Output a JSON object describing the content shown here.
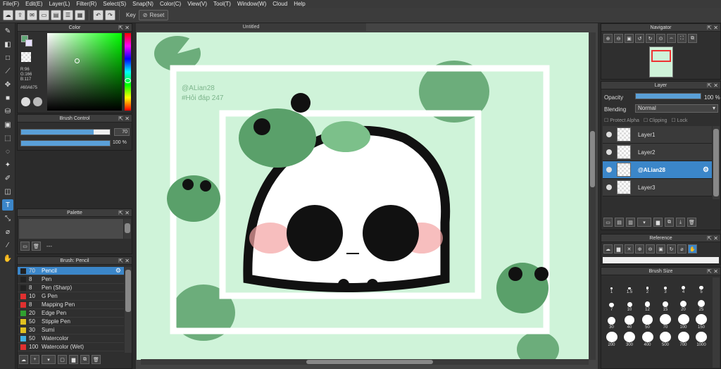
{
  "menu": [
    "File(F)",
    "Edit(E)",
    "Layer(L)",
    "Filter(R)",
    "Select(S)",
    "Snap(N)",
    "Color(C)",
    "View(V)",
    "Tool(T)",
    "Window(W)",
    "Cloud",
    "Help"
  ],
  "toolbar": {
    "key_label": "Key",
    "reset_label": "Reset"
  },
  "color_panel": {
    "title": "Color",
    "r": "R:96",
    "g": "G:166",
    "b": "B:117",
    "hex": "#60A675",
    "fg_color": "#60A675"
  },
  "brush_control": {
    "title": "Brush Control",
    "size_value": "70",
    "opacity_value": "100 %",
    "size_fraction": 0.82,
    "opacity_fraction": 1.0
  },
  "palette": {
    "title": "Palette",
    "dash": "---"
  },
  "brush_list": {
    "title": "Brush: Pencil",
    "items": [
      {
        "size": "70",
        "name": "Pencil",
        "color": "#222222",
        "selected": true
      },
      {
        "size": "8",
        "name": "Pen",
        "color": "#222222"
      },
      {
        "size": "8",
        "name": "Pen (Sharp)",
        "color": "#222222"
      },
      {
        "size": "10",
        "name": "G Pen",
        "color": "#e03030"
      },
      {
        "size": "8",
        "name": "Mapping Pen",
        "color": "#e03030"
      },
      {
        "size": "20",
        "name": "Edge Pen",
        "color": "#30a030"
      },
      {
        "size": "50",
        "name": "Stipple Pen",
        "color": "#e0c020"
      },
      {
        "size": "30",
        "name": "Sumi",
        "color": "#e0c020"
      },
      {
        "size": "50",
        "name": "Watercolor",
        "color": "#40b0e0"
      },
      {
        "size": "100",
        "name": "Watercolor (Wet)",
        "color": "#e03030"
      }
    ]
  },
  "document": {
    "title": "Untitled",
    "watermark_line1": "@ALian28",
    "watermark_line2": "#Hỏi đáp 247"
  },
  "navigator": {
    "title": "Navigator"
  },
  "layer_panel": {
    "title": "Layer",
    "opacity_label": "Opacity",
    "opacity_value": "100 %",
    "blending_label": "Blending",
    "blending_value": "Normal",
    "protect_alpha": "Protect Alpha",
    "clipping": "Clipping",
    "lock": "Lock",
    "layers": [
      {
        "name": "Layer1",
        "selected": false
      },
      {
        "name": "Layer2",
        "selected": false
      },
      {
        "name": "@ALian28",
        "selected": true
      },
      {
        "name": "Layer3",
        "selected": false
      }
    ]
  },
  "reference": {
    "title": "Reference"
  },
  "brush_size": {
    "title": "Brush Size",
    "sizes": [
      "1",
      "1.5",
      "2",
      "3",
      "4",
      "5",
      "7",
      "10",
      "12",
      "15",
      "20",
      "25",
      "30",
      "40",
      "50",
      "70",
      "100",
      "150",
      "200",
      "300",
      "400",
      "500",
      "700",
      "1000"
    ]
  }
}
